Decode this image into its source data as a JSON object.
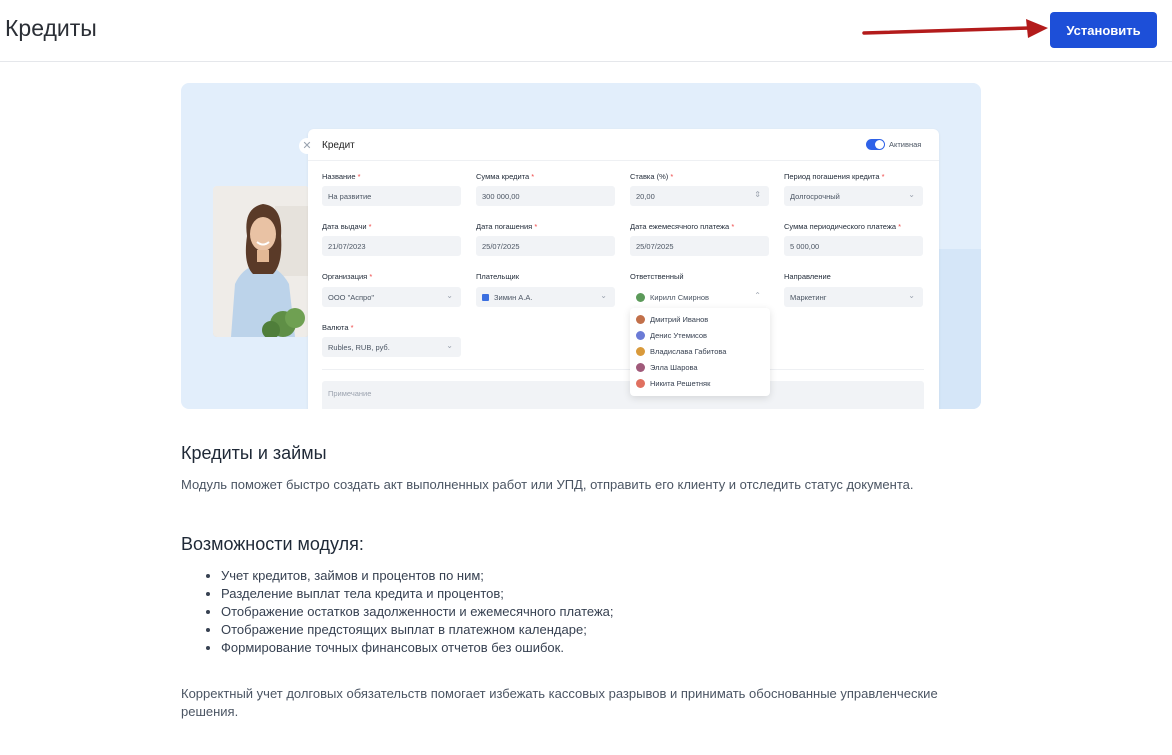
{
  "header": {
    "title": "Кредиты",
    "install_label": "Установить",
    "arrow_color": "#b31b1b"
  },
  "hero": {
    "card": {
      "title": "Кредит",
      "active_label": "Активная",
      "fields": {
        "name": {
          "label": "Название",
          "value": "На развитие"
        },
        "amount": {
          "label": "Сумма кредита",
          "value": "300 000,00"
        },
        "rate": {
          "label": "Ставка (%)",
          "value": "20,00"
        },
        "period": {
          "label": "Период погашения кредита",
          "value": "Долгосрочный"
        },
        "issue_date": {
          "label": "Дата выдачи",
          "value": "21/07/2023"
        },
        "repay_date": {
          "label": "Дата погашения",
          "value": "25/07/2025"
        },
        "monthly_date": {
          "label": "Дата ежемесячного платежа",
          "value": "25/07/2025"
        },
        "periodic_sum": {
          "label": "Сумма периодического платежа",
          "value": "5 000,00"
        },
        "organization": {
          "label": "Организация",
          "value": "ООО \"Аспро\""
        },
        "payer": {
          "label": "Плательщик",
          "value": "Зимин А.А."
        },
        "responsible": {
          "label": "Ответственный",
          "value": "Кирилл Смирнов"
        },
        "direction": {
          "label": "Направление",
          "value": "Маркетинг"
        },
        "currency": {
          "label": "Валюта",
          "value": "Rubles, RUB, руб."
        }
      },
      "note_placeholder": "Примечание",
      "responsible_options": [
        {
          "name": "Дмитрий Иванов",
          "color": "#c2704a"
        },
        {
          "name": "Денис Утемисов",
          "color": "#6b7bd6"
        },
        {
          "name": "Владислава Габитова",
          "color": "#d99a3b"
        },
        {
          "name": "Элла Шарова",
          "color": "#a05a7a"
        },
        {
          "name": "Никита Решетняк",
          "color": "#e07060"
        }
      ]
    }
  },
  "content": {
    "heading": "Кредиты и займы",
    "description": "Модуль поможет быстро создать акт выполненных работ или УПД, отправить его клиенту и отследить статус документа.",
    "features_heading": "Возможности модуля:",
    "features": [
      "Учет кредитов, займов и процентов по ним;",
      "Разделение выплат тела кредита и процентов;",
      "Отображение остатков задолженности и ежемесячного платежа;",
      "Отображение предстоящих выплат в платежном календаре;",
      "Формирование точных финансовых отчетов без ошибок."
    ],
    "footer_text": "Корректный учет долговых обязательств помогает избежать кассовых разрывов и принимать обоснованные управленческие решения."
  }
}
